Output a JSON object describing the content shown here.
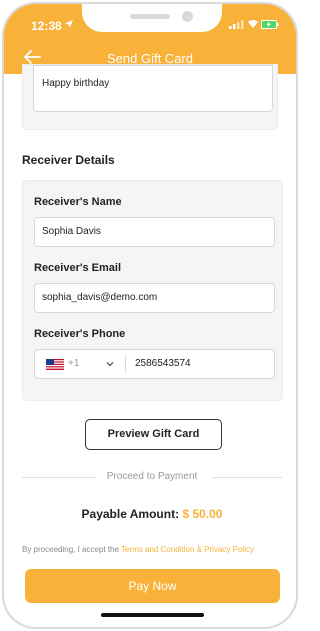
{
  "status_bar": {
    "time": "12:38"
  },
  "header": {
    "title": "Send Gift Card"
  },
  "message": {
    "text": "Happy birthday"
  },
  "receiver": {
    "section_title": "Receiver Details",
    "name_label": "Receiver's Name",
    "name_value": "Sophia Davis",
    "email_label": "Receiver's Email",
    "email_value": "sophia_davis@demo.com",
    "phone_label": "Receiver's Phone",
    "country_code": "+1",
    "phone_value": "2586543574"
  },
  "preview_button": "Preview Gift Card",
  "proceed_divider": "Proceed to Payment",
  "payable": {
    "label": "Payable Amount:",
    "amount": "$ 50.00"
  },
  "terms": {
    "prefix": "By proceeding, I accept the",
    "link": "Terms and Condition & Privacy Policy"
  },
  "pay_button": "Pay Now",
  "colors": {
    "accent": "#f8b239",
    "card_bg": "#f5f5f5"
  },
  "icons": {
    "back": "arrow-left-icon",
    "flag": "us-flag-icon",
    "chevron": "chevron-down-icon"
  }
}
